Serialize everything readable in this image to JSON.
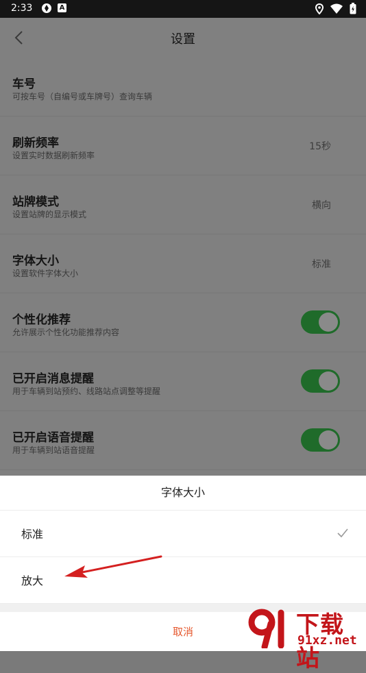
{
  "status_bar": {
    "time": "2:33",
    "badge_letter": "A"
  },
  "nav": {
    "title": "设置"
  },
  "settings": [
    {
      "title": "车号",
      "subtitle": "可按车号（自编号或车牌号）查询车辆",
      "value": ""
    },
    {
      "title": "刷新频率",
      "subtitle": "设置实时数据刷新频率",
      "value": "15秒"
    },
    {
      "title": "站牌模式",
      "subtitle": "设置站牌的显示模式",
      "value": "横向"
    },
    {
      "title": "字体大小",
      "subtitle": "设置软件字体大小",
      "value": "标准"
    },
    {
      "title": "个性化推荐",
      "subtitle": "允许展示个性化功能推荐内容",
      "toggle": true
    },
    {
      "title": "已开启消息提醒",
      "subtitle": "用于车辆到站预约、线路站点调整等提醒",
      "toggle": true
    },
    {
      "title": "已开启语音提醒",
      "subtitle": "用于车辆到站语音提醒",
      "toggle": true
    }
  ],
  "sheet": {
    "title": "字体大小",
    "options": [
      {
        "label": "标准",
        "selected": true
      },
      {
        "label": "放大",
        "selected": false
      }
    ],
    "cancel_label": "取消"
  },
  "watermark": {
    "title": "下载站",
    "domain": "91xz.net"
  },
  "colors": {
    "accent": "#e5582e",
    "toggle_on": "#1f6b2a",
    "watermark": "#c3151a"
  }
}
